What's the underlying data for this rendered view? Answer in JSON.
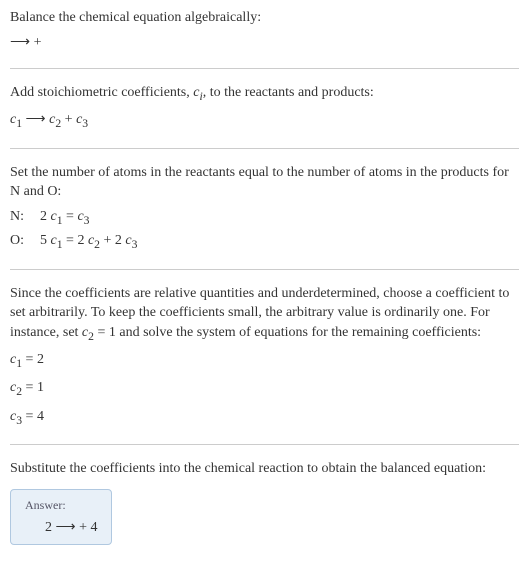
{
  "s1": {
    "heading": "Balance the chemical equation algebraically:",
    "eq": " ⟶  + "
  },
  "s2": {
    "heading_a": "Add stoichiometric coefficients, ",
    "ci": "c",
    "ci_sub": "i",
    "heading_b": ", to the reactants and products:",
    "eq_c1": "c",
    "eq_c1n": "1",
    "arrow": " ⟶ ",
    "eq_c2": "c",
    "eq_c2n": "2",
    "plus": "  + ",
    "eq_c3": "c",
    "eq_c3n": "3"
  },
  "s3": {
    "heading": "Set the number of atoms in the reactants equal to the number of atoms in the products for N and O:",
    "rows": [
      {
        "label": "N: ",
        "lhs_coef": "2 ",
        "lhs_c": "c",
        "lhs_n": "1",
        "eq": " = ",
        "rhs_c1": "c",
        "rhs_n1": "3"
      },
      {
        "label": "O: ",
        "lhs_coef": "5 ",
        "lhs_c": "c",
        "lhs_n": "1",
        "eq": " = 2 ",
        "rhs_c1": "c",
        "rhs_n1": "2",
        "plus": " + 2 ",
        "rhs_c2": "c",
        "rhs_n2": "3"
      }
    ]
  },
  "s4": {
    "heading_a": "Since the coefficients are relative quantities and underdetermined, choose a coefficient to set arbitrarily. To keep the coefficients small, the arbitrary value is ordinarily one. For instance, set ",
    "c2": "c",
    "c2n": "2",
    "heading_b": " = 1 and solve the system of equations for the remaining coefficients:",
    "rows": [
      {
        "c": "c",
        "n": "1",
        "val": " = 2"
      },
      {
        "c": "c",
        "n": "2",
        "val": " = 1"
      },
      {
        "c": "c",
        "n": "3",
        "val": " = 4"
      }
    ]
  },
  "s5": {
    "heading": "Substitute the coefficients into the chemical reaction to obtain the balanced equation:",
    "answer_label": "Answer:",
    "answer_eq": "2  ⟶  + 4 "
  }
}
